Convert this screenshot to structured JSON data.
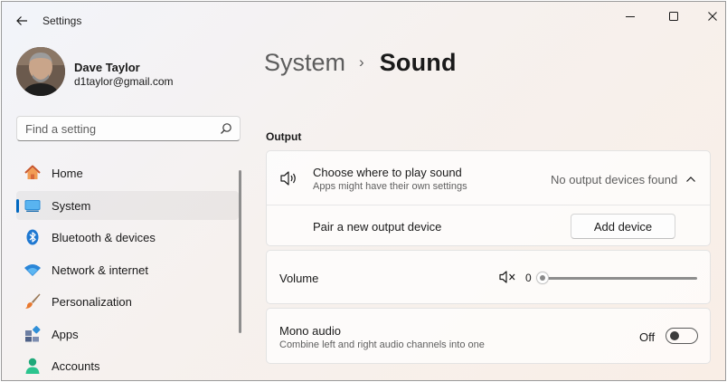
{
  "window": {
    "title": "Settings"
  },
  "profile": {
    "name": "Dave Taylor",
    "email": "d1taylor@gmail.com"
  },
  "search": {
    "placeholder": "Find a setting"
  },
  "nav": {
    "items": [
      {
        "label": "Home",
        "icon": "home-icon",
        "selected": false
      },
      {
        "label": "System",
        "icon": "system-icon",
        "selected": true
      },
      {
        "label": "Bluetooth & devices",
        "icon": "bluetooth-icon",
        "selected": false
      },
      {
        "label": "Network & internet",
        "icon": "wifi-icon",
        "selected": false
      },
      {
        "label": "Personalization",
        "icon": "brush-icon",
        "selected": false
      },
      {
        "label": "Apps",
        "icon": "apps-icon",
        "selected": false
      },
      {
        "label": "Accounts",
        "icon": "accounts-icon",
        "selected": false
      }
    ]
  },
  "breadcrumb": {
    "parent": "System",
    "separator": "›",
    "current": "Sound"
  },
  "output": {
    "section_title": "Output",
    "title": "Choose where to play sound",
    "subtitle": "Apps might have their own settings",
    "status": "No output devices found",
    "pair_label": "Pair a new output device",
    "add_button": "Add device"
  },
  "volume": {
    "label": "Volume",
    "value": "0",
    "muted": true
  },
  "mono": {
    "title": "Mono audio",
    "subtitle": "Combine left and right audio channels into one",
    "state_label": "Off",
    "enabled": false
  },
  "colors": {
    "accent": "#0067c0",
    "text_primary": "#1a1a1a",
    "text_secondary": "#5f5f5f"
  }
}
